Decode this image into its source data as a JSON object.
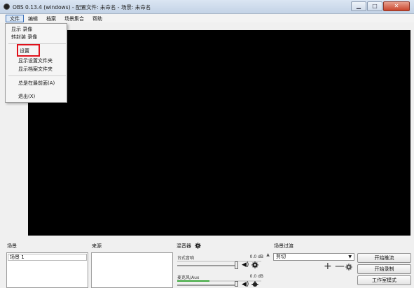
{
  "window": {
    "title": "OBS 0.13.4 (windows) - 配置文件: 未命名 - 场景: 未命名",
    "minimize_glyph": "▁",
    "maximize_glyph": "□",
    "close_glyph": "✕"
  },
  "menubar": {
    "items": [
      {
        "label": "文件",
        "active": true
      },
      {
        "label": "编辑"
      },
      {
        "label": "档案"
      },
      {
        "label": "场景集合"
      },
      {
        "label": "帮助"
      }
    ]
  },
  "file_menu": {
    "items": [
      {
        "label": "显示 录像"
      },
      {
        "label": "转封装 录像"
      },
      {
        "label": "设置",
        "highlighted": true
      },
      {
        "label": "显示设置文件夹"
      },
      {
        "label": "显示档案文件夹"
      },
      {
        "label": "总是在最前面(A)"
      },
      {
        "label": "退出(X)"
      }
    ]
  },
  "panels": {
    "scenes": {
      "label": "场景",
      "items": [
        "场景 1"
      ]
    },
    "sources": {
      "label": "来源",
      "items": []
    },
    "mixer": {
      "label": "混音器",
      "channels": [
        {
          "name": "台式音响",
          "db": "0.0 dB",
          "level_fraction": 0.0
        },
        {
          "name": "麦克风/Aux",
          "db": "0.0 dB",
          "level_fraction": 0.38
        }
      ],
      "volume_glyph": "◀)",
      "scroll_up_glyph": "▲"
    },
    "transitions": {
      "label": "场景过渡",
      "selected": "剪切",
      "add_glyph": "+",
      "remove_glyph": "—"
    }
  },
  "controls": {
    "start_streaming": "开始推流",
    "start_recording": "开始录制",
    "studio_mode": "工作室模式"
  },
  "colors": {
    "preview_bg": "#000000",
    "highlight": "#e0111b",
    "meter_green": "#3aa83a"
  }
}
